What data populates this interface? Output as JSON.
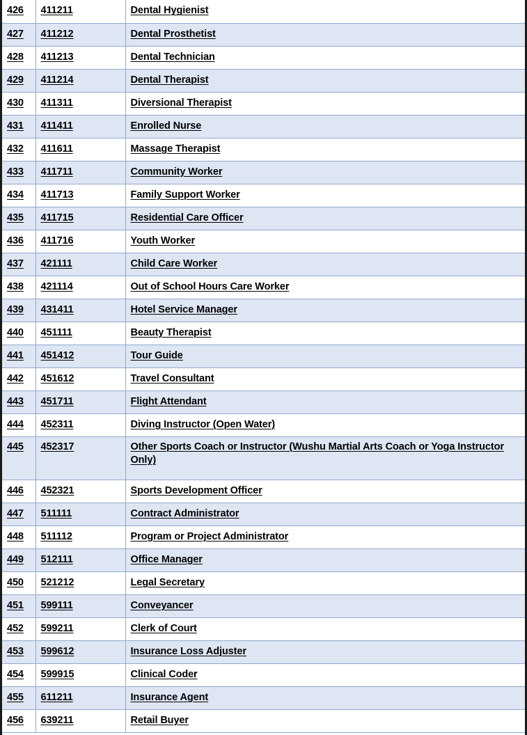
{
  "table": {
    "columns": [
      "row_number",
      "occupation_code",
      "occupation_name"
    ],
    "rows": [
      {
        "num": "426",
        "code": "411211",
        "name": "Dental Hygienist",
        "shaded": false,
        "tall": false
      },
      {
        "num": "427",
        "code": "411212",
        "name": "Dental Prosthetist",
        "shaded": true,
        "tall": false
      },
      {
        "num": "428",
        "code": "411213",
        "name": "Dental Technician",
        "shaded": false,
        "tall": false
      },
      {
        "num": "429",
        "code": "411214",
        "name": "Dental Therapist",
        "shaded": true,
        "tall": false
      },
      {
        "num": "430",
        "code": "411311",
        "name": "Diversional Therapist",
        "shaded": false,
        "tall": false
      },
      {
        "num": "431",
        "code": "411411",
        "name": "Enrolled Nurse",
        "shaded": true,
        "tall": false
      },
      {
        "num": "432",
        "code": "411611",
        "name": "Massage Therapist",
        "shaded": false,
        "tall": false
      },
      {
        "num": "433",
        "code": "411711",
        "name": "Community Worker",
        "shaded": true,
        "tall": false
      },
      {
        "num": "434",
        "code": "411713",
        "name": "Family Support Worker",
        "shaded": false,
        "tall": false
      },
      {
        "num": "435",
        "code": "411715",
        "name": "Residential Care Officer",
        "shaded": true,
        "tall": false
      },
      {
        "num": "436",
        "code": "411716",
        "name": "Youth Worker",
        "shaded": false,
        "tall": false
      },
      {
        "num": "437",
        "code": "421111",
        "name": "Child Care Worker",
        "shaded": true,
        "tall": false
      },
      {
        "num": "438",
        "code": "421114",
        "name": "Out of School Hours Care Worker",
        "shaded": false,
        "tall": false
      },
      {
        "num": "439",
        "code": "431411",
        "name": "Hotel Service Manager",
        "shaded": true,
        "tall": false
      },
      {
        "num": "440",
        "code": "451111",
        "name": "Beauty Therapist",
        "shaded": false,
        "tall": false
      },
      {
        "num": "441",
        "code": "451412",
        "name": "Tour Guide",
        "shaded": true,
        "tall": false
      },
      {
        "num": "442",
        "code": "451612",
        "name": "Travel Consultant",
        "shaded": false,
        "tall": false
      },
      {
        "num": "443",
        "code": "451711",
        "name": "Flight Attendant",
        "shaded": true,
        "tall": false
      },
      {
        "num": "444",
        "code": "452311",
        "name": "Diving Instructor (Open Water)",
        "shaded": false,
        "tall": false
      },
      {
        "num": "445",
        "code": "452317",
        "name": "Other Sports Coach or Instructor (Wushu Martial Arts Coach or Yoga Instructor Only)",
        "shaded": true,
        "tall": true
      },
      {
        "num": "446",
        "code": "452321",
        "name": "Sports Development Officer",
        "shaded": false,
        "tall": false
      },
      {
        "num": "447",
        "code": "511111",
        "name": "Contract Administrator",
        "shaded": true,
        "tall": false
      },
      {
        "num": "448",
        "code": "511112",
        "name": "Program or Project Administrator",
        "shaded": false,
        "tall": false
      },
      {
        "num": "449",
        "code": "512111",
        "name": "Office Manager",
        "shaded": true,
        "tall": false
      },
      {
        "num": "450",
        "code": "521212",
        "name": "Legal Secretary",
        "shaded": false,
        "tall": false
      },
      {
        "num": "451",
        "code": "599111",
        "name": "Conveyancer",
        "shaded": true,
        "tall": false
      },
      {
        "num": "452",
        "code": "599211",
        "name": "Clerk of Court",
        "shaded": false,
        "tall": false
      },
      {
        "num": "453",
        "code": "599612",
        "name": "Insurance Loss Adjuster",
        "shaded": true,
        "tall": false
      },
      {
        "num": "454",
        "code": "599915",
        "name": "Clinical Coder",
        "shaded": false,
        "tall": false
      },
      {
        "num": "455",
        "code": "611211",
        "name": "Insurance Agent",
        "shaded": true,
        "tall": false
      },
      {
        "num": "456",
        "code": "639211",
        "name": "Retail Buyer",
        "shaded": false,
        "tall": false
      }
    ]
  },
  "colors": {
    "row_shade": "#dee5f3",
    "grid_line": "#8faacc",
    "page_border": "#1a1a1a",
    "text": "#000000"
  }
}
